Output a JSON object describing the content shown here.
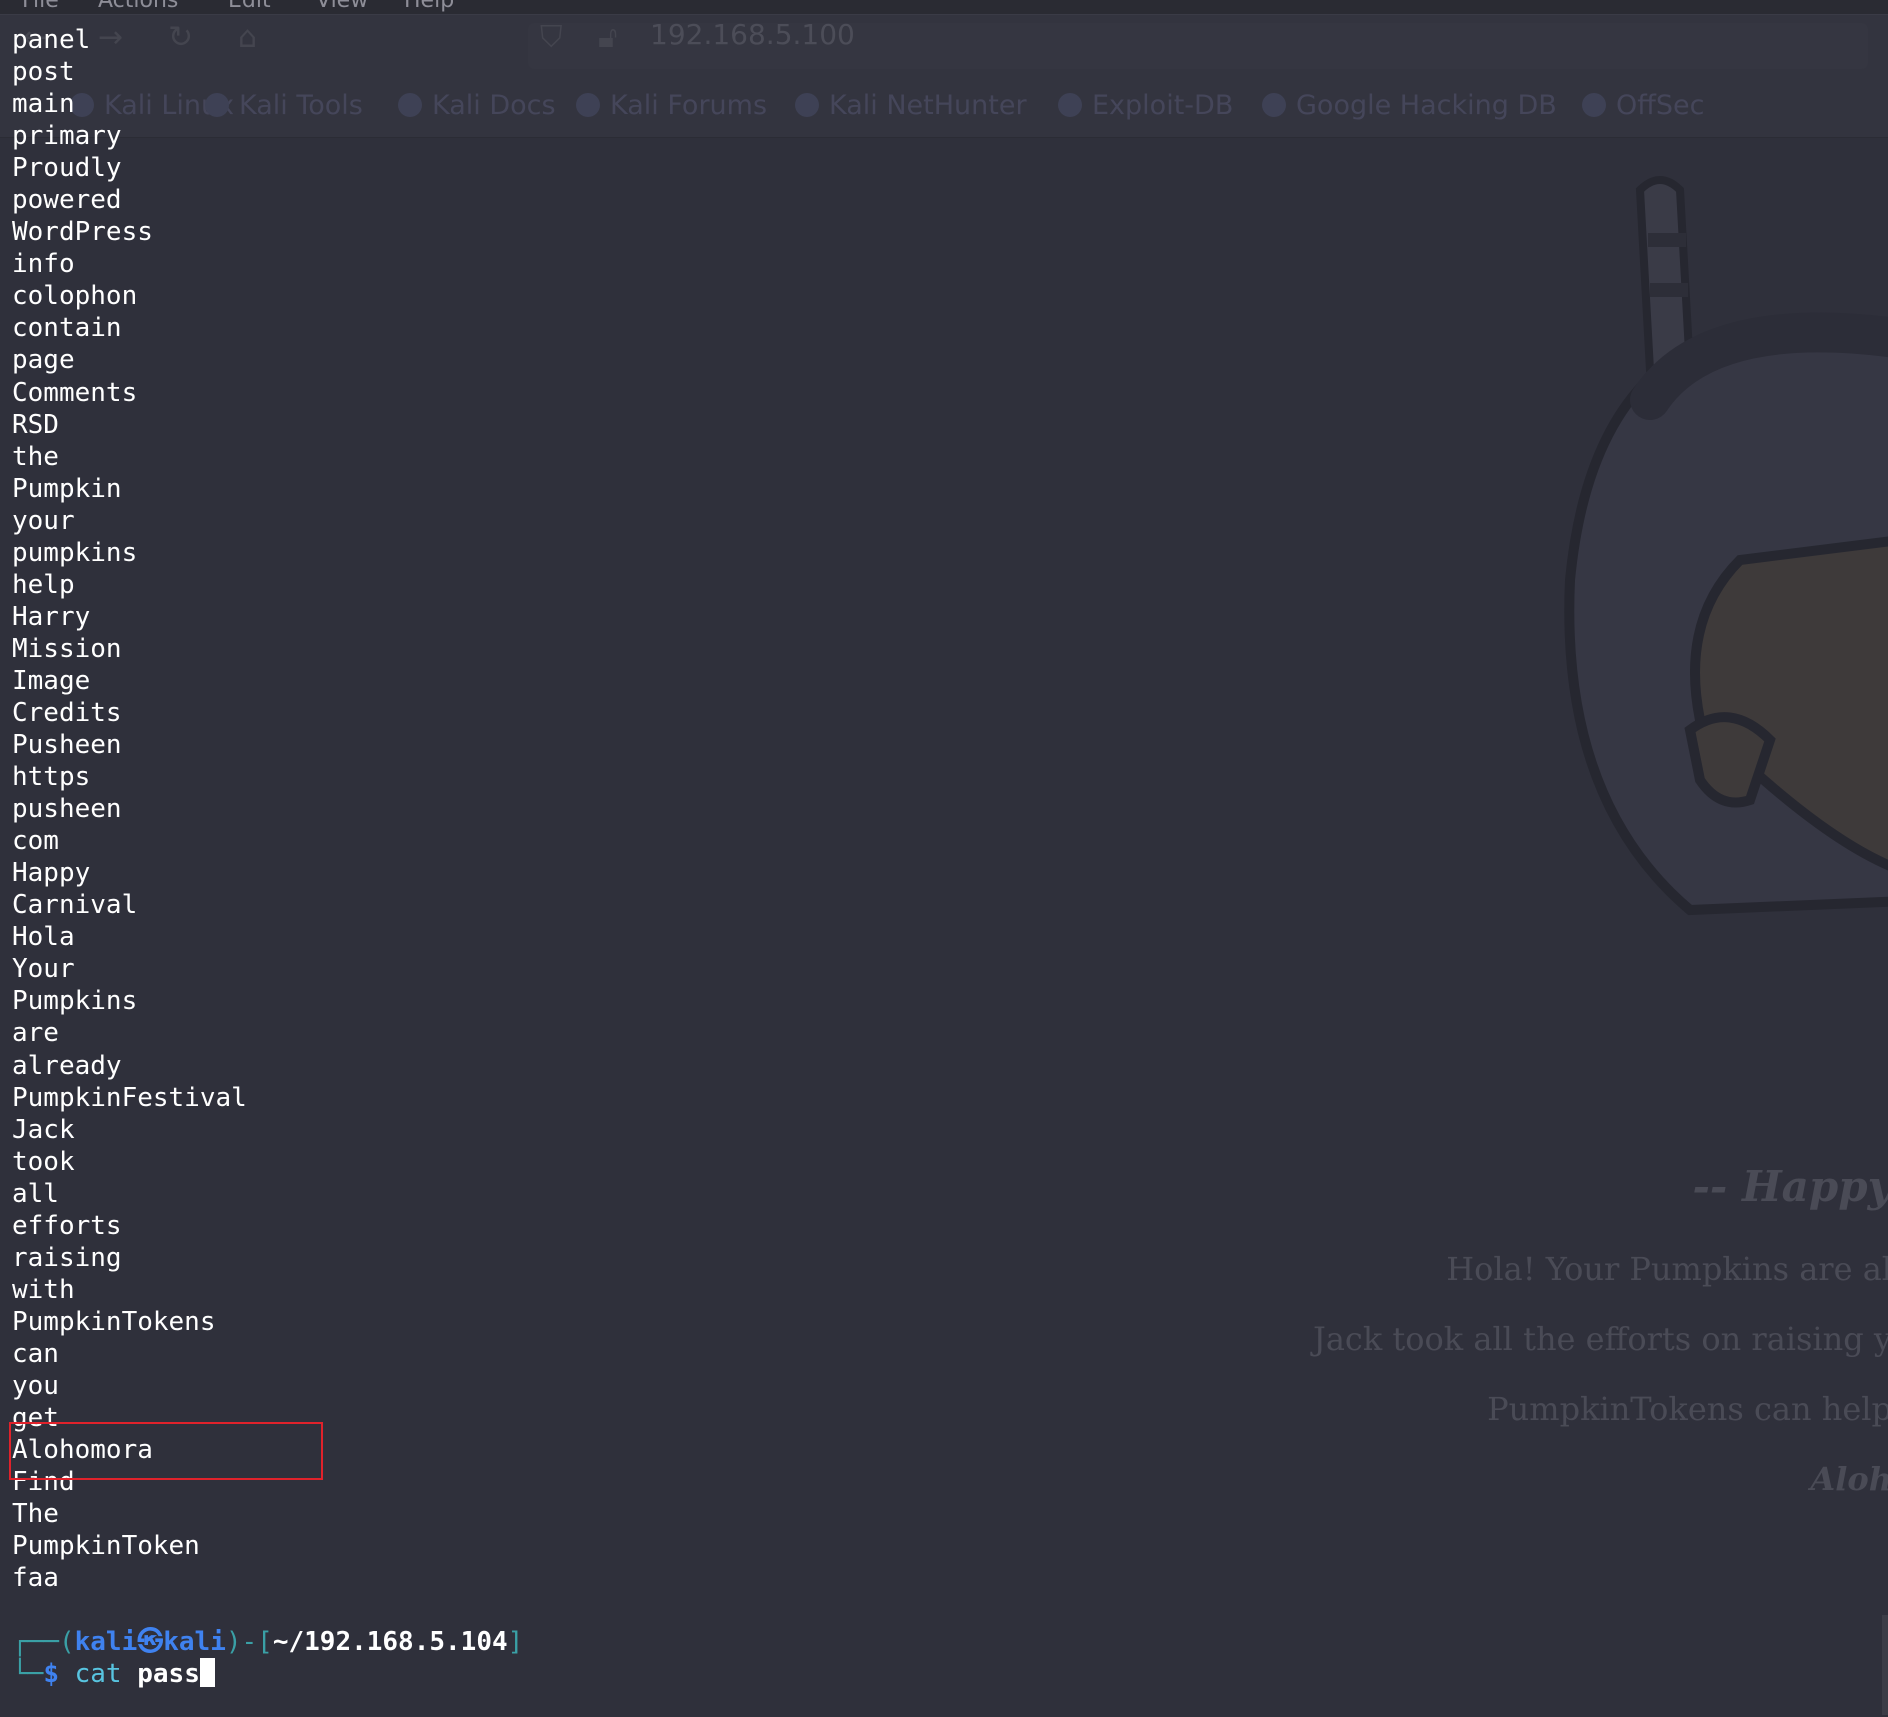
{
  "background_browser": {
    "menu": [
      "File",
      "Actions",
      "Edit",
      "View",
      "Help"
    ],
    "url": "192.168.5.100",
    "bookmarks": [
      "Kali Linux",
      "Kali Tools",
      "Kali Docs",
      "Kali Forums",
      "Kali NetHunter",
      "Exploit-DB",
      "Google Hacking DB",
      "OffSec"
    ],
    "page_text": {
      "heading": "-- Happy",
      "line1": "Hola! Your Pumpkins are al",
      "line2": "Jack took all the efforts on raising y",
      "line3": "PumpkinTokens can help",
      "line4": "Aloh"
    }
  },
  "terminal": {
    "output_lines": [
      "panel",
      "post",
      "main",
      "primary",
      "Proudly",
      "powered",
      "WordPress",
      "info",
      "colophon",
      "contain",
      "page",
      "Comments",
      "RSD",
      "the",
      "Pumpkin",
      "your",
      "pumpkins",
      "help",
      "Harry",
      "Mission",
      "Image",
      "Credits",
      "Pusheen",
      "https",
      "pusheen",
      "com",
      "Happy",
      "Carnival",
      "Hola",
      "Your",
      "Pumpkins",
      "are",
      "already",
      "PumpkinFestival",
      "Jack",
      "took",
      "all",
      "efforts",
      "raising",
      "with",
      "PumpkinTokens",
      "can",
      "you",
      "get",
      "Alohomora",
      "Find",
      "The",
      "PumpkinToken",
      "faa"
    ],
    "highlighted_word": "Alohomora",
    "prompt": {
      "frame_top": "┌──(",
      "user": "kali㉿kali",
      "mid": ")-[",
      "path": "~/192.168.5.104",
      "end": "]",
      "frame_bottom": "└─",
      "symbol": "$",
      "command": "cat",
      "argument": "pass"
    }
  },
  "colors": {
    "terminal_bg": "#2f303b",
    "text": "#ffffff",
    "prompt_frame": "#3aa0a6",
    "prompt_user": "#3f82f0",
    "command": "#58c4e0",
    "highlight_border": "#e0222b"
  }
}
